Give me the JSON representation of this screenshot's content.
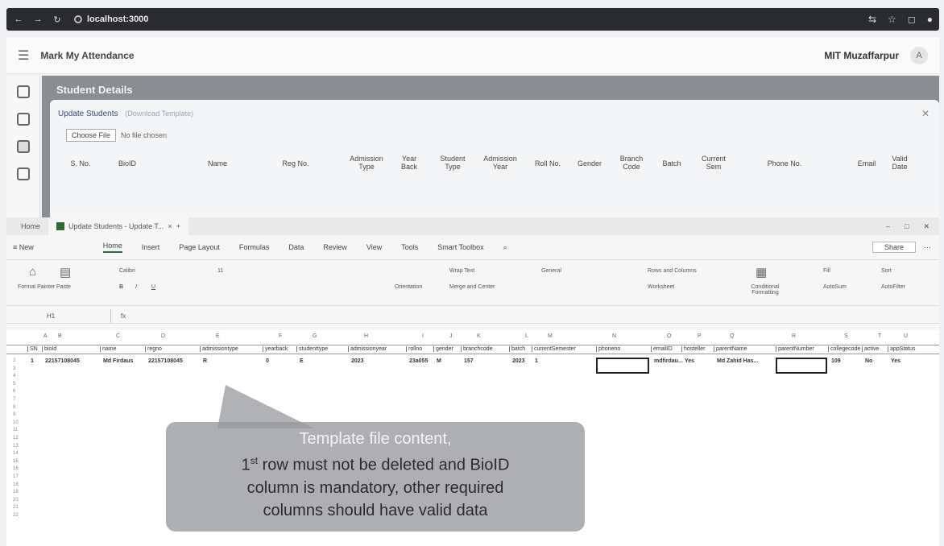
{
  "browser": {
    "url": "localhost:3000"
  },
  "app": {
    "title": "Mark My Attendance",
    "org": "MIT Muzaffarpur",
    "avatar": "A"
  },
  "details": {
    "title": "Student Details",
    "modal_title": "Update Students",
    "modal_link": "(Download Template)",
    "choose_file": "Choose File",
    "no_file": "No file chosen",
    "columns": [
      "S. No.",
      "BioID",
      "Name",
      "Reg No.",
      "Admission\nType",
      "Year\nBack",
      "Student\nType",
      "Admission\nYear",
      "Roll No.",
      "Gender",
      "Branch\nCode",
      "Batch",
      "Current\nSem",
      "Phone No.",
      "Email",
      "Valid\nDate"
    ]
  },
  "sheet": {
    "tabs": [
      "Home",
      "Update Students - Update T..."
    ],
    "quick": "New",
    "menus": [
      "Home",
      "Insert",
      "Page Layout",
      "Formulas",
      "Data",
      "Review",
      "View",
      "Tools",
      "Smart Toolbox"
    ],
    "share": "Share",
    "ribbon": {
      "format_painter": "Format Painter",
      "paste": "Paste",
      "font": "Calibri",
      "size": "11",
      "wrap": "Wrap Text",
      "merge": "Merge and Center",
      "orientation": "Orientation",
      "number_format": "General",
      "rows_cols": "Rows and Columns",
      "worksheet": "Worksheet",
      "cond_format": "Conditional Formatting",
      "fill": "Fill",
      "sort": "Sort",
      "autosum": "AutoSum",
      "autofilter": "AutoFilter"
    },
    "namebox": "H1",
    "fx": "fx",
    "col_letters": [
      "A",
      "B",
      "C",
      "D",
      "E",
      "F",
      "G",
      "H",
      "I",
      "J",
      "K",
      "L",
      "M",
      "N",
      "O",
      "P",
      "Q",
      "R",
      "S",
      "T",
      "U"
    ],
    "headers": [
      "SN",
      "bioId",
      "name",
      "regno",
      "admissiontype",
      "yearback",
      "studenttype",
      "admissionyear",
      "rollno",
      "gender",
      "branchcode",
      "batch",
      "currentSemester",
      "phoneno",
      "emailID",
      "hosteller",
      "parentName",
      "parentNumber",
      "collegecode",
      "active",
      "appStatus"
    ],
    "row": [
      "1",
      "22157108045",
      "Md Firdaus",
      "22157108045",
      "R",
      "0",
      "E",
      "2023",
      "23a055",
      "M",
      "157",
      "2023",
      "1",
      "",
      "mdfirdau...",
      "Yes",
      "Md Zahid Has...",
      "",
      "109",
      "No",
      "Yes"
    ]
  },
  "callout": {
    "line1": "Template file content,",
    "line2_sup": "st",
    "line2_pre": "1",
    "line2_rest": " row must not be deleted and BioID",
    "line3": "column is mandatory, other required",
    "line4": "columns should have valid data"
  }
}
